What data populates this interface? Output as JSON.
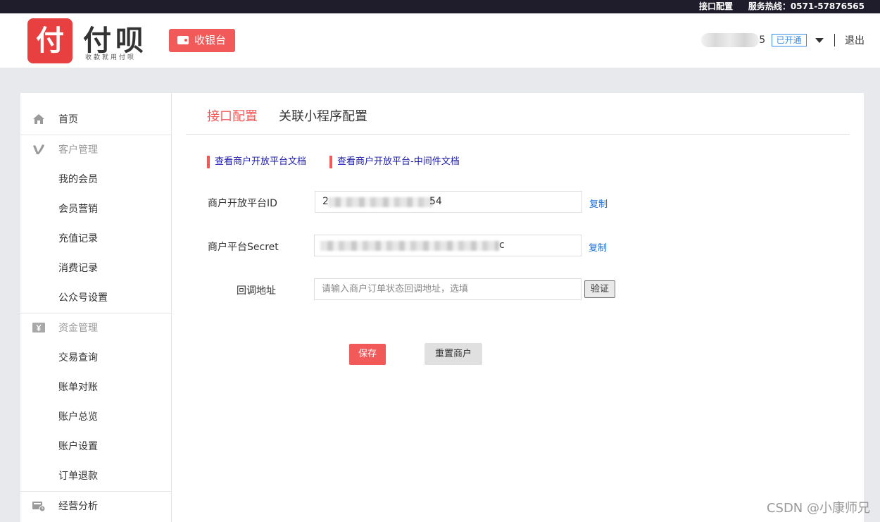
{
  "topbar": {
    "api_config": "接口配置",
    "hotline": "服务热线：0571-57876565"
  },
  "header": {
    "logo_char": "付",
    "brand_name": "付呗",
    "slogan": "收款就用付呗",
    "cashier_label": "收银台",
    "user_suffix": "5",
    "status_badge": "已开通",
    "logout": "退出"
  },
  "sidebar": {
    "home": "首页",
    "customer_group": "客户管理",
    "customer_items": [
      "我的会员",
      "会员营销",
      "充值记录",
      "消费记录",
      "公众号设置"
    ],
    "fund_group": "资金管理",
    "fund_items": [
      "交易查询",
      "账单对账",
      "账户总览",
      "账户设置",
      "订单退款"
    ],
    "analysis": "经营分析",
    "icons": {
      "home": "home-icon",
      "customer": "v-logo-icon",
      "fund": "yen-icon",
      "analysis": "analysis-icon"
    }
  },
  "main": {
    "tabs": [
      {
        "label": "接口配置",
        "active": true
      },
      {
        "label": "关联小程序配置",
        "active": false
      }
    ],
    "doc_links": [
      "查看商户开放平台文档",
      "查看商户开放平台-中间件文档"
    ],
    "fields": {
      "merchant_id": {
        "label": "商户开放平台ID",
        "visible_start": "2",
        "visible_end": "54",
        "copy": "复制"
      },
      "secret": {
        "label": "商户平台Secret",
        "visible_end": "c",
        "copy": "复制"
      },
      "callback": {
        "label": "回调地址",
        "placeholder": "请输入商户订单状态回调地址，选填",
        "verify": "验证"
      }
    },
    "save_label": "保存",
    "reset_label": "重置商户"
  },
  "watermark": "CSDN @小康师兄",
  "colors": {
    "accent": "#f25a5a",
    "link": "#1a6fd6",
    "doc_link": "#1a1aa8",
    "topbar": "#1f1d2b"
  }
}
